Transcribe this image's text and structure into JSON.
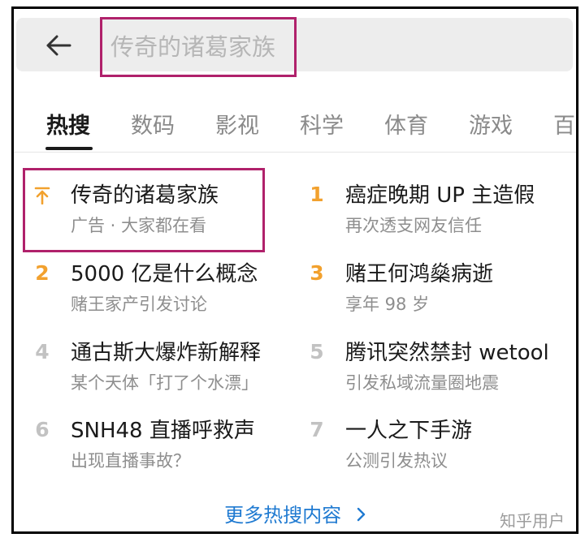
{
  "search": {
    "placeholder": "传奇的诸葛家族"
  },
  "tabs": [
    {
      "label": "热搜",
      "active": true
    },
    {
      "label": "数码"
    },
    {
      "label": "影视"
    },
    {
      "label": "科学"
    },
    {
      "label": "体育"
    },
    {
      "label": "游戏"
    },
    {
      "label": "百"
    }
  ],
  "hot_list": [
    {
      "rank": "",
      "title": "传奇的诸葛家族",
      "sub": "广告 · 大家都在看",
      "icon": "up-arrow-icon"
    },
    {
      "rank": "1",
      "title": "癌症晚期 UP 主造假",
      "sub": "再次透支网友信任"
    },
    {
      "rank": "2",
      "title": "5000 亿是什么概念",
      "sub": "赌王家产引发讨论"
    },
    {
      "rank": "3",
      "title": "赌王何鸿燊病逝",
      "sub": "享年 98 岁"
    },
    {
      "rank": "4",
      "title": "通古斯大爆炸新解释",
      "sub": "某个天体「打了个水漂」"
    },
    {
      "rank": "5",
      "title": "腾讯突然禁封 wetool",
      "sub": "引发私域流量圈地震"
    },
    {
      "rank": "6",
      "title": "SNH48 直播呼救声",
      "sub": "出现直播事故？"
    },
    {
      "rank": "7",
      "title": "一人之下手游",
      "sub": "公测引发热议"
    }
  ],
  "more_link": {
    "label": "更多热搜内容",
    "icon": "chevron-right-icon"
  },
  "watermark": "知乎用户",
  "colors": {
    "accent_hot": "#f2a12e",
    "link": "#1f7ad1",
    "annotation": "#b0216b"
  }
}
